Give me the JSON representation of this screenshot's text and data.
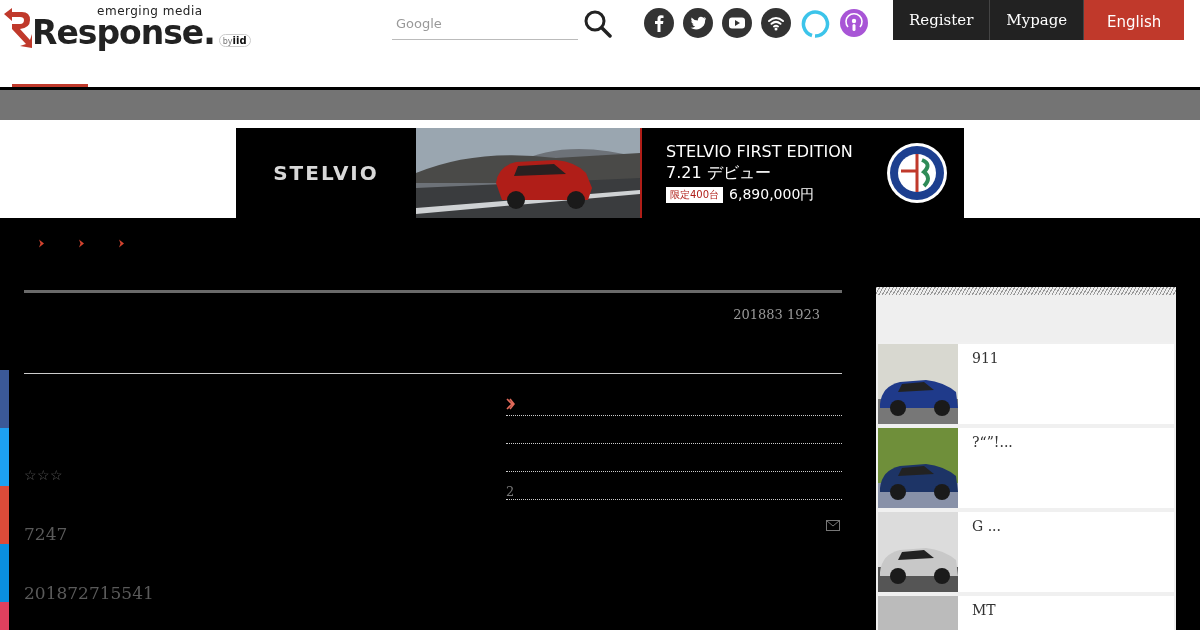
{
  "logo": {
    "tagline": "emerging media",
    "name": "Response.",
    "byline_prefix": "by",
    "byline": "iid"
  },
  "search": {
    "placeholder": "Google"
  },
  "social": [
    {
      "kind": "facebook"
    },
    {
      "kind": "twitter"
    },
    {
      "kind": "youtube"
    },
    {
      "kind": "rss"
    },
    {
      "kind": "alexa"
    },
    {
      "kind": "podcast"
    }
  ],
  "account": [
    {
      "label": "Register",
      "kind": "dark"
    },
    {
      "label": "Mypage",
      "kind": "dark"
    },
    {
      "label": "English",
      "kind": "accent"
    }
  ],
  "nav": [
    {
      "selected": true
    }
  ],
  "banner": {
    "brand": "STELVIO",
    "headline": "STELVIO FIRST EDITION",
    "date": "7.21 デビュー",
    "badge": "限定400台",
    "price": "6,890,000円"
  },
  "article": {
    "date": "201883 1923",
    "rating": "☆☆☆",
    "views": "7247",
    "posted": "201872715541"
  },
  "share": [
    {
      "color": "#3b5998"
    },
    {
      "color": "#1da1f2"
    },
    {
      "color": "#dd4b39"
    },
    {
      "color": "#0a8fe0"
    },
    {
      "color": "#e0405e"
    }
  ],
  "related": {
    "text": "2"
  },
  "sidebar": {
    "items": [
      {
        "title": "911"
      },
      {
        "title": " ?“”!..."
      },
      {
        "title": "G ..."
      },
      {
        "title": "MT"
      }
    ]
  }
}
